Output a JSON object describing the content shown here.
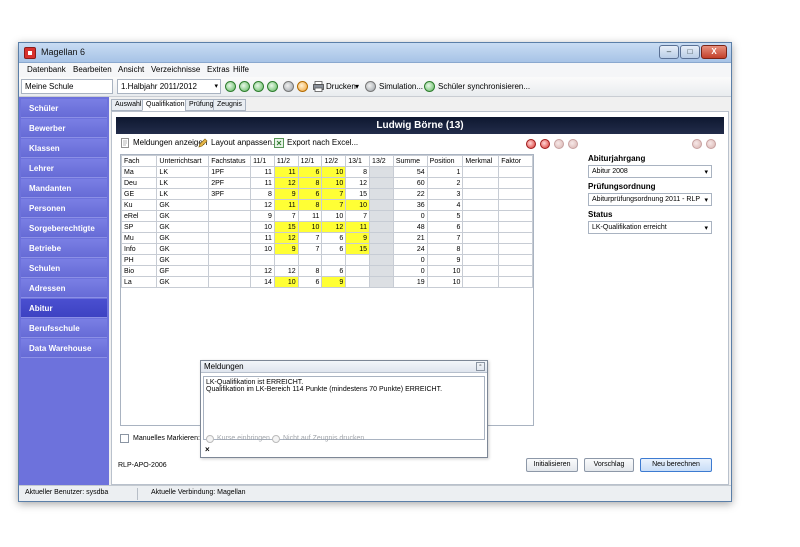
{
  "window": {
    "title": "Magellan 6",
    "minimize": "–",
    "maximize": "□",
    "close": "X"
  },
  "menu": [
    {
      "label": "Datenbank"
    },
    {
      "label": "Bearbeiten"
    },
    {
      "label": "Ansicht"
    },
    {
      "label": "Verzeichnisse"
    },
    {
      "label": "Extras"
    },
    {
      "label": "Hilfe"
    }
  ],
  "toolbar": {
    "school": "Meine Schule",
    "period": "1.Halbjahr 2011/2012",
    "print": "Drucken",
    "simulation": "Simulation...",
    "sync": "Schüler synchronisieren..."
  },
  "sidebar": {
    "items": [
      {
        "label": "Schüler"
      },
      {
        "label": "Bewerber"
      },
      {
        "label": "Klassen"
      },
      {
        "label": "Lehrer"
      },
      {
        "label": "Mandanten"
      },
      {
        "label": "Personen"
      },
      {
        "label": "Sorgeberechtigte"
      },
      {
        "label": "Betriebe"
      },
      {
        "label": "Schulen"
      },
      {
        "label": "Adressen"
      },
      {
        "label": "Abitur"
      },
      {
        "label": "Berufsschule"
      },
      {
        "label": "Data Warehouse"
      }
    ]
  },
  "tabs": [
    {
      "label": "Auswahl"
    },
    {
      "label": "Qualifikation"
    },
    {
      "label": "Prüfung"
    },
    {
      "label": "Zeugnis"
    }
  ],
  "student": {
    "name": "Ludwig Börne (13)"
  },
  "actions": {
    "messages": "Meldungen anzeigen",
    "layout": "Layout anpassen...",
    "export": "Export nach Excel..."
  },
  "grid": {
    "headers": [
      "Fach",
      "Unterrichtsart",
      "Fachstatus",
      "11/1",
      "11/2",
      "12/1",
      "12/2",
      "13/1",
      "13/2",
      "Summe",
      "Position",
      "Merkmal",
      "Faktor"
    ],
    "rows": [
      {
        "c": [
          "Ma",
          "LK",
          "1PF",
          "11",
          "11",
          "6",
          "10",
          "8",
          "",
          "54",
          "1",
          "",
          ""
        ],
        "h": [
          4,
          5,
          6
        ]
      },
      {
        "c": [
          "Deu",
          "LK",
          "2PF",
          "11",
          "12",
          "8",
          "10",
          "12",
          "",
          "60",
          "2",
          "",
          ""
        ],
        "h": [
          4,
          5,
          6
        ]
      },
      {
        "c": [
          "GE",
          "LK",
          "3PF",
          "8",
          "9",
          "6",
          "7",
          "15",
          "",
          "22",
          "3",
          "",
          ""
        ],
        "h": [
          4,
          5,
          6
        ]
      },
      {
        "c": [
          "Ku",
          "GK",
          "",
          "12",
          "11",
          "8",
          "7",
          "10",
          "",
          "36",
          "4",
          "",
          ""
        ],
        "h": [
          4,
          5,
          6,
          7
        ]
      },
      {
        "c": [
          "eRel",
          "GK",
          "",
          "9",
          "7",
          "11",
          "10",
          "7",
          "",
          "0",
          "5",
          "",
          ""
        ],
        "h": []
      },
      {
        "c": [
          "SP",
          "GK",
          "",
          "10",
          "15",
          "10",
          "12",
          "11",
          "",
          "48",
          "6",
          "",
          ""
        ],
        "h": [
          4,
          5,
          6,
          7
        ]
      },
      {
        "c": [
          "Mu",
          "GK",
          "",
          "11",
          "12",
          "7",
          "6",
          "9",
          "",
          "21",
          "7",
          "",
          ""
        ],
        "h": [
          4,
          7
        ]
      },
      {
        "c": [
          "Info",
          "GK",
          "",
          "10",
          "9",
          "7",
          "6",
          "15",
          "",
          "24",
          "8",
          "",
          ""
        ],
        "h": [
          4,
          7
        ]
      },
      {
        "c": [
          "PH",
          "GK",
          "",
          "",
          "",
          "",
          "",
          "",
          "",
          "0",
          "9",
          "",
          ""
        ],
        "h": []
      },
      {
        "c": [
          "Bio",
          "GF",
          "",
          "12",
          "12",
          "8",
          "6",
          "",
          "",
          "0",
          "10",
          "",
          ""
        ],
        "h": []
      },
      {
        "c": [
          "La",
          "GK",
          "",
          "14",
          "10",
          "6",
          "9",
          "",
          "",
          "19",
          "10",
          "",
          ""
        ],
        "h": [
          4,
          6
        ]
      }
    ]
  },
  "right": {
    "abitur_label": "Abiturjahrgang",
    "abitur_value": "Abitur 2008",
    "pruefung_label": "Prüfungsordnung",
    "pruefung_value": "Abiturprüfungsordnung 2011 - RLP",
    "status_label": "Status",
    "status_value": "LK-Qualifikation erreicht"
  },
  "dialog": {
    "title": "Meldungen",
    "line1": "LK-Qualifikation ist ERREICHT.",
    "line2": "Qualifikation im LK-Bereich 114 Punkte (mindestens 70 Punkte) ERREICHT.",
    "close": "×"
  },
  "options": {
    "manual": "Manuelles Markieren:",
    "courses": "Kurse einbringen",
    "noprint": "Nicht auf Zeugnis drucken"
  },
  "footer": {
    "regulation": "RLP-APO-2006",
    "init": "Initialisieren",
    "suggest": "Vorschlag",
    "recalc": "Neu berechnen"
  },
  "status": {
    "user": "Aktueller Benutzer: sysdba",
    "connection": "Aktuelle Verbindung: Magellan"
  },
  "colors": {
    "sidebar": "#6d72dc",
    "highlight": "#ffff35",
    "namebar": "#0e1830"
  }
}
